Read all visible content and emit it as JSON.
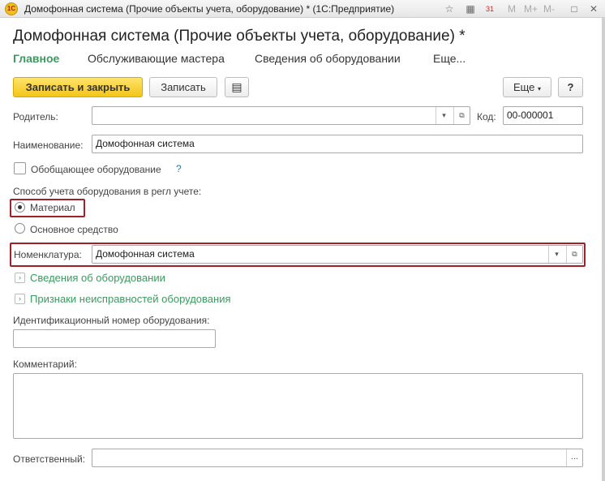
{
  "window": {
    "title": "Домофонная система (Прочие объекты учета, оборудование) * (1С:Предприятие)",
    "logo": "1С",
    "toolbar_m": "M",
    "toolbar_mplus": "M+",
    "toolbar_mminus": "M-"
  },
  "form": {
    "title": "Домофонная система (Прочие объекты учета, оборудование) *"
  },
  "tabs": [
    {
      "label": "Главное"
    },
    {
      "label": "Обслуживающие мастера"
    },
    {
      "label": "Сведения об оборудовании"
    },
    {
      "label": "Еще..."
    }
  ],
  "toolbar": {
    "save_close_label": "Записать и закрыть",
    "save_label": "Записать",
    "more_label": "Еще",
    "help_label": "?"
  },
  "fields": {
    "parent_label": "Родитель:",
    "parent_value": "",
    "code_label": "Код:",
    "code_value": "00-000001",
    "name_label": "Наименование:",
    "name_value": "Домофонная система",
    "group_equipment_label": "Обобщающее оборудование",
    "group_equipment_help": "?",
    "accounting_method_label": "Способ учета оборудования в регл учете:",
    "option_material": "Материал",
    "option_fixed_asset": "Основное средство",
    "selected_option": "Материал",
    "nomenclature_label": "Номенклатура:",
    "nomenclature_value": "Домофонная система",
    "equipment_info_group": "Сведения об оборудовании",
    "malfunction_group": "Признаки неисправностей оборудования",
    "id_number_label": "Идентификационный номер оборудования:",
    "id_number_value": "",
    "comment_label": "Комментарий:",
    "comment_value": "",
    "responsible_label": "Ответственный:",
    "responsible_value": ""
  },
  "colors": {
    "accent_green": "#3c9a5f",
    "primary_button": "#f3c51a",
    "highlight_red": "#a0202a"
  }
}
